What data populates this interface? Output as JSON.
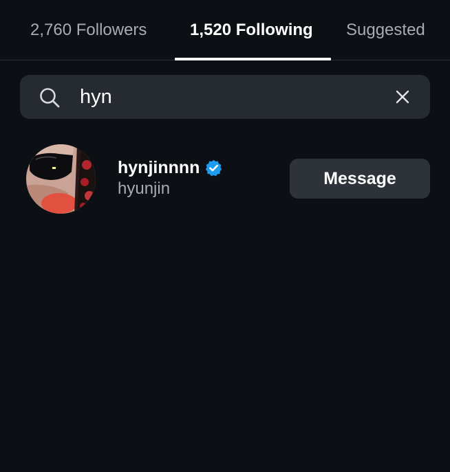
{
  "tabs": {
    "followers": "2,760 Followers",
    "following": "1,520 Following",
    "suggested": "Suggested",
    "active": "following"
  },
  "search": {
    "value": "hyn",
    "icon": "search-icon",
    "clear_icon": "close-icon"
  },
  "results": [
    {
      "username": "hynjinnnn",
      "full_name": "hyunjin",
      "verified": true,
      "button_label": "Message"
    }
  ],
  "colors": {
    "background": "#0c0f14",
    "search_bg": "#262a31",
    "button_bg": "#2e3239",
    "secondary_text": "#a8acb3",
    "verified_blue": "#1d9bf0"
  }
}
